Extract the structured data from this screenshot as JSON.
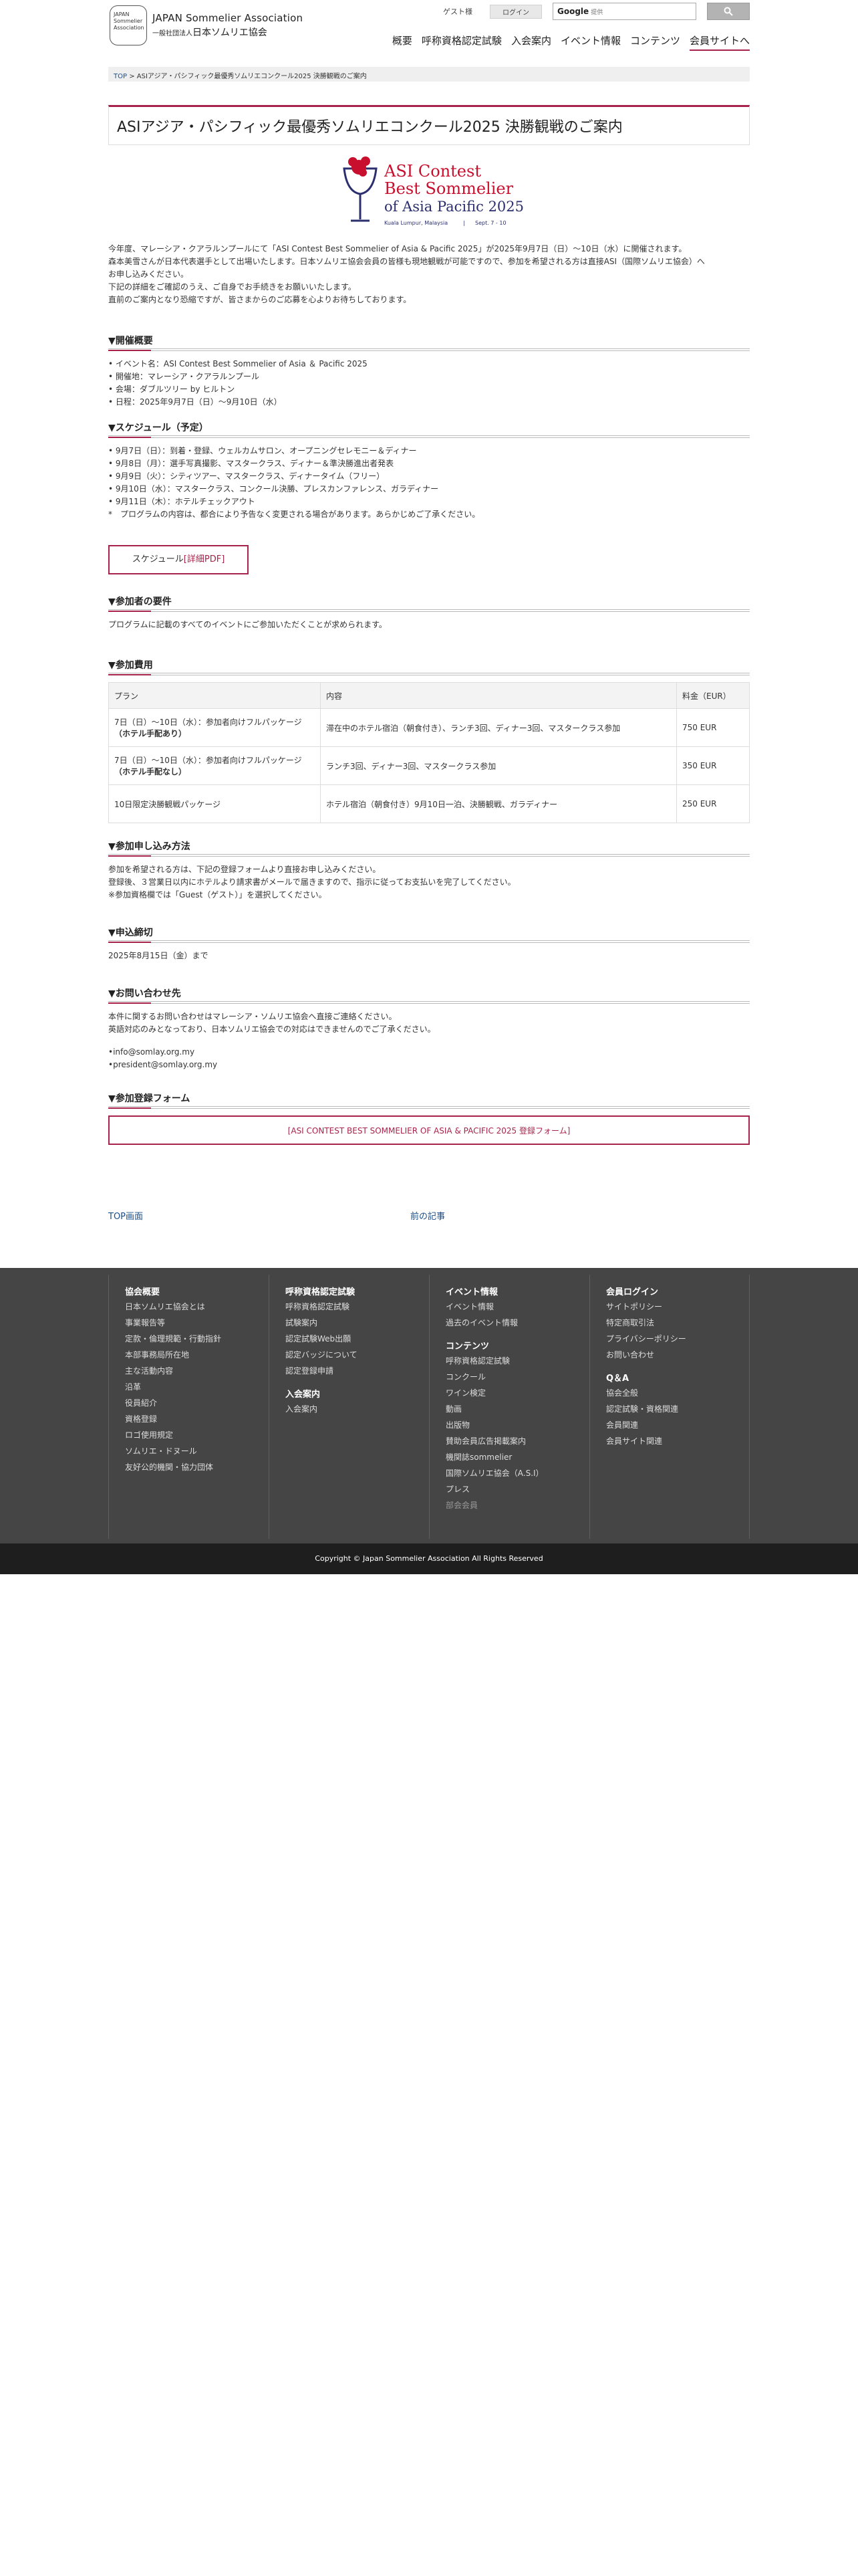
{
  "header": {
    "logo_mark": "JAPAN Sommelier Association",
    "logo_en": "JAPAN Sommelier Association",
    "logo_ja_prefix": "一般社団法人",
    "logo_ja": "日本ソムリエ協会",
    "guest": "ゲスト様",
    "login": "ログイン",
    "search_brand": "Google",
    "search_suffix": "提供",
    "nav": [
      "概要",
      "呼称資格認定試験",
      "入会案内",
      "イベント情報",
      "コンテンツ",
      "会員サイトへ"
    ]
  },
  "breadcrumb": {
    "home": "TOP",
    "sep": ">",
    "current": "ASIアジア・パシフィック最優秀ソムリエコンクール2025 決勝観戦のご案内"
  },
  "title": "ASIアジア・パシフィック最優秀ソムリエコンクール2025 決勝観戦のご案内",
  "hero": {
    "line1": "ASI Contest",
    "line2": "Best Sommelier",
    "line3": "of Asia Pacific 2025",
    "place": "Kuala Lumpur, Malaysia",
    "sep": "|",
    "dates": "Sept. 7 - 10"
  },
  "intro": [
    "今年度、マレーシア・クアラルンプールにて「ASI Contest Best Sommelier of Asia & Pacific 2025」が2025年9月7日（日）～10日（水）に開催されます。",
    "森本美雪さんが日本代表選手として出場いたします。日本ソムリエ協会会員の皆様も現地観戦が可能ですので、参加を希望される方は直接ASI（国際ソムリエ協会）へ",
    "お申し込みください。",
    "下記の詳細をご確認のうえ、ご自身でお手続きをお願いいたします。",
    "直前のご案内となり恐縮ですが、皆さまからのご応募を心よりお待ちしております。"
  ],
  "overview": {
    "heading": "▼開催概要",
    "items": [
      "• イベント名：ASI Contest Best Sommelier of Asia ＆ Pacific 2025",
      "• 開催地：マレーシア・クアラルンプール",
      "• 会場：ダブルツリー by ヒルトン",
      "• 日程：2025年9月7日（日）〜9月10日（水）"
    ]
  },
  "schedule": {
    "heading": "▼スケジュール（予定）",
    "items": [
      "• 9月7日（日）：到着・登録、ウェルカムサロン、オープニングセレモニー＆ディナー",
      "• 9月8日（月）：選手写真撮影、マスタークラス、ディナー＆準決勝進出者発表",
      "• 9月9日（火）：シティツアー、マスタークラス、ディナータイム（フリー）",
      "• 9月10日（水）：マスタークラス、コンクール決勝、プレスカンファレンス、ガラディナー",
      "• 9月11日（木）：ホテルチェックアウト",
      "*　プログラムの内容は、都合により予告なく変更される場合があります。あらかじめご了承ください。"
    ],
    "pdf_prefix": "スケジュール",
    "pdf_link": "[詳細PDF]"
  },
  "requirements": {
    "heading": "▼参加者の要件",
    "text": "プログラムに記載のすべてのイベントにご参加いただくことが求められます。"
  },
  "fees": {
    "heading": "▼参加費用",
    "columns": [
      "プラン",
      "内容",
      "料金（EUR）"
    ],
    "rows": [
      {
        "plan": "7日（日）〜10日（水）：参加者向けフルパッケージ",
        "plan_b": "（ホテル手配あり）",
        "content": "滞在中のホテル宿泊（朝食付き）、ランチ3回、ディナー3回、マスタークラス参加",
        "fee": "750 EUR"
      },
      {
        "plan": "7日（日）〜10日（水）：参加者向けフルパッケージ",
        "plan_b": "（ホテル手配なし）",
        "content": "ランチ3回、ディナー3回、マスタークラス参加",
        "fee": "350 EUR"
      },
      {
        "plan": "10日限定決勝観戦パッケージ",
        "plan_b": "",
        "content": "ホテル宿泊（朝食付き）9月10日一泊、決勝観戦、ガラディナー",
        "fee": "250 EUR"
      }
    ]
  },
  "apply": {
    "heading": "▼参加申し込み方法",
    "lines": [
      "参加を希望される方は、下記の登録フォームより直接お申し込みください。",
      "登録後、３営業日以内にホテルより請求書がメールで届きますので、指示に従ってお支払いを完了してください。",
      "※参加資格欄では「Guest（ゲスト）」を選択してください。"
    ]
  },
  "deadline": {
    "heading": "▼申込締切",
    "text": "2025年8月15日（金）まで"
  },
  "contact": {
    "heading": "▼お問い合わせ先",
    "lines": [
      "本件に関するお問い合わせはマレーシア・ソムリエ協会へ直接ご連絡ください。",
      "英語対応のみとなっており、日本ソムリエ協会での対応はできませんのでご了承ください。"
    ],
    "emails": [
      "•info@somlay.org.my",
      "•president@somlay.org.my"
    ]
  },
  "form": {
    "heading": "▼参加登録フォーム",
    "link": "[ASI CONTEST BEST SOMMELIER OF ASIA & PACIFIC 2025 登録フォーム]"
  },
  "pager": {
    "top": "TOP画面",
    "prev": "前の記事"
  },
  "footer": {
    "col1": {
      "title": "協会概要",
      "items": [
        "日本ソムリエ協会とは",
        "事業報告等",
        "定款・倫理規範・行動指針",
        "本部事務局所在地",
        "主な活動内容",
        "沿革",
        "役員紹介",
        "資格登録",
        "ロゴ使用規定",
        "ソムリエ・ドヌール",
        "友好公的機関・協力団体"
      ]
    },
    "col2": {
      "title": "呼称資格認定試験",
      "items": [
        "呼称資格認定試験",
        "試験案内",
        "認定試験Web出願",
        "認定バッジについて",
        "認定登録申請"
      ],
      "title2": "入会案内",
      "items2": [
        "入会案内"
      ]
    },
    "col3": {
      "title": "イベント情報",
      "items": [
        "イベント情報",
        "過去のイベント情報"
      ],
      "title2": "コンテンツ",
      "items2": [
        "呼称資格認定試験",
        "コンクール",
        "ワイン検定",
        "動画",
        "出版物",
        "賛助会員広告掲載案内",
        "機関誌sommelier",
        "国際ソムリエ協会（A.S.I）",
        "プレス"
      ],
      "dim": "部会会員"
    },
    "col4": {
      "title": "会員ログイン",
      "items": [
        "サイトポリシー",
        "特定商取引法",
        "プライバシーポリシー",
        "お問い合わせ"
      ],
      "title2": "Q＆A",
      "items2": [
        "協会全般",
        "認定試験・資格関連",
        "会員関連",
        "会員サイト関連"
      ]
    },
    "copyright": "Copyright © Japan Sommelier Association All Rights Reserved"
  },
  "colors": {
    "accent": "#a8234b",
    "link": "#1a4f8b",
    "footer_bg": "#454545",
    "copyright_bg": "#1e1e1e"
  }
}
